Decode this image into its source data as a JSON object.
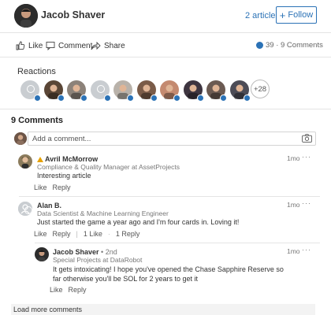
{
  "author": {
    "name": "Jacob Shaver",
    "articles_label": "2 articles",
    "follow_label": "Follow"
  },
  "actions": {
    "like_label": "Like",
    "comment_label": "Comment",
    "share_label": "Share",
    "counts_label": "39 · 9 Comments"
  },
  "reactions": {
    "title": "Reactions",
    "more_label": "+28",
    "avatars": [
      "ghost",
      "photo",
      "photo",
      "ghost",
      "photo",
      "photo",
      "photo",
      "photo",
      "photo",
      "photo"
    ]
  },
  "comments": {
    "title": "9 Comments",
    "placeholder": "Add a comment...",
    "load_more_label": "Load more comments",
    "items": [
      {
        "name": "Avril McMorrow",
        "headline": "Compliance & Quality Manager at AssetProjects",
        "text": "Interesting article",
        "time": "1mo",
        "like_label": "Like",
        "reply_label": "Reply"
      },
      {
        "name": "Alan B.",
        "headline": "Data Scientist & Machine Learning Engineer",
        "text": "Just started the game a year ago and I'm four cards in. Loving it!",
        "time": "1mo",
        "like_label": "Like",
        "reply_label": "Reply",
        "likes_count": "1 Like",
        "replies_count": "1 Reply"
      },
      {
        "name": "Jacob Shaver",
        "degree": "• 2nd",
        "headline": "Special Projects at DataRobot",
        "text": "It gets intoxicating! I hope you've opened the Chase Sapphire Reserve so far otherwise you'll be SOL for 2 years to get it",
        "time": "1mo",
        "like_label": "Like",
        "reply_label": "Reply"
      }
    ]
  },
  "colors": {
    "accent": "#2b72b6",
    "warning": "#e6a100"
  }
}
